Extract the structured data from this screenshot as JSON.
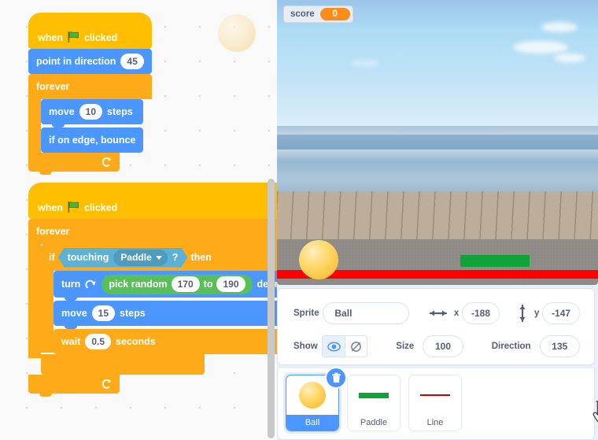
{
  "code_area": {
    "name": "code-canvas",
    "scripts": [
      {
        "id": "script-1",
        "blocks": [
          {
            "type": "hat",
            "category": "events",
            "words": [
              "when",
              "clicked"
            ],
            "icon": "green-flag-icon"
          },
          {
            "type": "stack",
            "category": "motion",
            "label": "point in direction",
            "value": "45"
          },
          {
            "type": "c-block",
            "category": "control",
            "label": "forever",
            "children": [
              {
                "type": "stack",
                "category": "motion",
                "label_before": "move",
                "value": "10",
                "label_after": "steps"
              },
              {
                "type": "stack",
                "category": "motion",
                "label": "if on edge, bounce"
              }
            ]
          }
        ]
      },
      {
        "id": "script-2",
        "blocks": [
          {
            "type": "hat",
            "category": "events",
            "words": [
              "when",
              "clicked"
            ],
            "icon": "green-flag-icon"
          },
          {
            "type": "c-block",
            "category": "control",
            "label": "forever",
            "children": [
              {
                "type": "if-block",
                "category": "control",
                "label_if": "if",
                "label_then": "then",
                "condition": {
                  "category": "sensing",
                  "label": "touching",
                  "dropdown": "Paddle",
                  "suffix": "?"
                },
                "children": [
                  {
                    "type": "stack",
                    "category": "motion",
                    "label_before": "turn",
                    "icon": "turn-clockwise-icon",
                    "operand": {
                      "category": "operator",
                      "label": "pick random",
                      "from": "170",
                      "to_label": "to",
                      "to": "190"
                    },
                    "label_after": "degrees"
                  },
                  {
                    "type": "stack",
                    "category": "motion",
                    "label_before": "move",
                    "value": "15",
                    "label_after": "steps"
                  },
                  {
                    "type": "stack",
                    "category": "control",
                    "label_before": "wait",
                    "value": "0.5",
                    "label_after": "seconds"
                  }
                ]
              }
            ]
          }
        ]
      }
    ]
  },
  "stage": {
    "score_monitor": {
      "label": "score",
      "value": "0"
    },
    "backdrop": "beach-pier-backdrop",
    "sprites_on_stage": [
      "ball",
      "paddle",
      "line"
    ]
  },
  "sprite_info": {
    "sprite_label": "Sprite",
    "sprite_name": "Ball",
    "x_label": "x",
    "x_value": "-188",
    "y_label": "y",
    "y_value": "-147",
    "show_label": "Show",
    "size_label": "Size",
    "size_value": "100",
    "direction_label": "Direction",
    "direction_value": "135",
    "show_visible_selected": true
  },
  "sprite_list": {
    "sprites": [
      {
        "name": "Ball",
        "thumb": "ball-thumb",
        "selected": true,
        "delete_badge": "delete-icon"
      },
      {
        "name": "Paddle",
        "thumb": "paddle-thumb",
        "selected": false
      },
      {
        "name": "Line",
        "thumb": "line-thumb",
        "selected": false
      }
    ]
  },
  "colors": {
    "motion": "#4c97ff",
    "events": "#ffbf00",
    "control": "#ffab19",
    "sensing": "#5cb1d6",
    "operator": "#59c059",
    "accent": "#4c97ff",
    "score_orange": "#ff8c1a",
    "paddle_green": "#11a23a",
    "line_red": "#fe0000"
  }
}
